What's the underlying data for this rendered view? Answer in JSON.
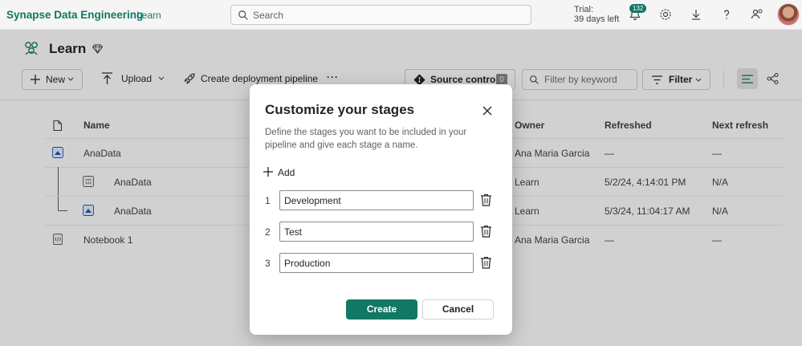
{
  "topbar": {
    "brand": "Synapse Data Engineering",
    "workspace_link": "Learn",
    "search_placeholder": "Search",
    "trial_line1": "Trial:",
    "trial_line2": "39 days left",
    "notification_count": "132"
  },
  "workspace": {
    "title": "Learn"
  },
  "toolbar": {
    "new_label": "New",
    "upload_label": "Upload",
    "create_pipeline_label": "Create deployment pipeline",
    "more_label": "···",
    "source_control_label": "Source control",
    "source_control_count": "0",
    "filter_placeholder": "Filter by keyword",
    "filter_label": "Filter"
  },
  "table": {
    "headers": {
      "name": "Name",
      "owner": "Owner",
      "refreshed": "Refreshed",
      "next_refresh": "Next refresh"
    },
    "rows": [
      {
        "name": "AnaData",
        "owner": "Ana Maria Garcia",
        "refreshed": "—",
        "next": "—"
      },
      {
        "name": "AnaData",
        "owner": "Learn",
        "refreshed": "5/2/24, 4:14:01 PM",
        "next": "N/A"
      },
      {
        "name": "AnaData",
        "owner": "Learn",
        "refreshed": "5/3/24, 11:04:17 AM",
        "next": "N/A"
      },
      {
        "name": "Notebook 1",
        "owner": "Ana Maria Garcia",
        "refreshed": "—",
        "next": "—"
      }
    ]
  },
  "dialog": {
    "title": "Customize your stages",
    "description": "Define the stages you want to be included in your pipeline and give each stage a name.",
    "add_label": "Add",
    "stages": [
      {
        "number": "1",
        "value": "Development"
      },
      {
        "number": "2",
        "value": "Test"
      },
      {
        "number": "3",
        "value": "Production"
      }
    ],
    "create_label": "Create",
    "cancel_label": "Cancel"
  },
  "colors": {
    "accent": "#117865",
    "overlay": "rgba(0,0,0,0.18)"
  }
}
